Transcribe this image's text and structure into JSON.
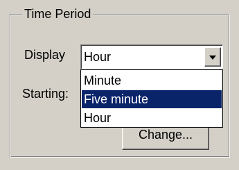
{
  "group": {
    "title": "Time Period"
  },
  "display": {
    "label": "Display",
    "value": "Hour",
    "options": [
      {
        "label": "Minute",
        "selected": false
      },
      {
        "label": "Five minute",
        "selected": true
      },
      {
        "label": "Hour",
        "selected": false
      }
    ]
  },
  "starting": {
    "label": "Starting:"
  },
  "buttons": {
    "change_label": "Change..."
  },
  "colors": {
    "face": "#d4d0c8",
    "highlight": "#0a246a"
  },
  "icons": {
    "dropdown": "chevron-down-icon"
  }
}
